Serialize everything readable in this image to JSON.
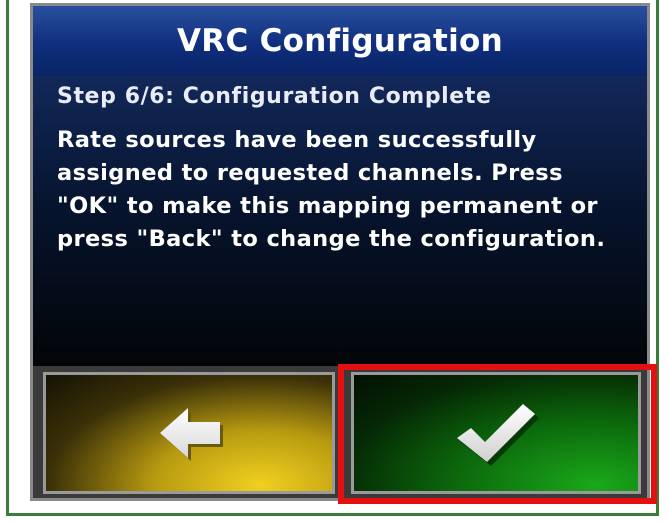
{
  "dialog": {
    "title": "VRC Configuration",
    "step": "Step 6/6: Configuration Complete",
    "message": "Rate sources have been successfully assigned to requested channels. Press \"OK\" to make this mapping permanent or press \"Back\" to change the configuration."
  },
  "buttons": {
    "back": {
      "icon": "left-arrow-icon",
      "color": "#d4b414"
    },
    "ok": {
      "icon": "checkmark-icon",
      "color": "#16a016"
    }
  },
  "highlight": {
    "color": "#e41010",
    "target": "ok-button"
  },
  "frame_color": "#3a7d3a"
}
